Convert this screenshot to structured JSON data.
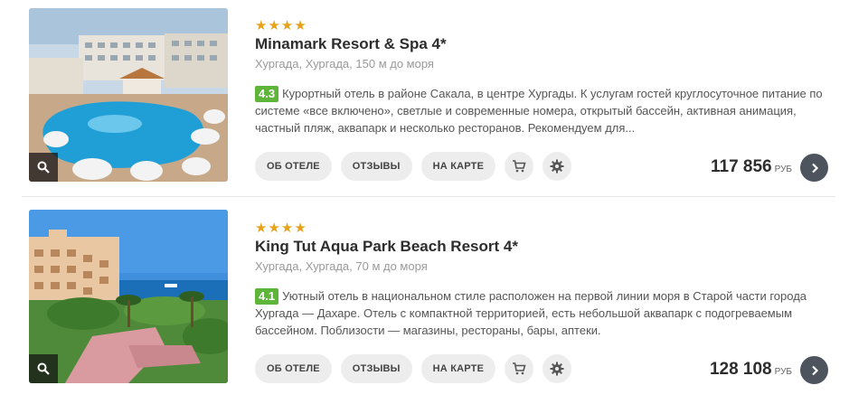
{
  "hotels": [
    {
      "stars": "★★★★",
      "name": "Minamark Resort & Spa 4*",
      "location": "Хургада, Хургада, 150 м до моря",
      "rating": "4.3",
      "description": "Курортный отель в районе Сакала, в центре Хургады. К услугам гостей круглосуточное питание по системе «все включено», светлые и современные номера, открытый бассейн, активная анимация, частный пляж, аквапарк и несколько ресторанов. Рекомендуем для...",
      "buttons": {
        "about": "ОБ ОТЕЛЕ",
        "reviews": "ОТЗЫВЫ",
        "map": "НА КАРТЕ"
      },
      "price": "117 856",
      "currency": "РУБ"
    },
    {
      "stars": "★★★★",
      "name": "King Tut Aqua Park Beach Resort 4*",
      "location": "Хургада, Хургада, 70 м до моря",
      "rating": "4.1",
      "description": "Уютный отель в национальном стиле расположен на первой линии моря в Старой части города Хургада — Дахаре. Отель с компактной территорией, есть небольшой аквапарк с подогреваемым бассейном. Поблизости — магазины, рестораны, бары, аптеки.",
      "buttons": {
        "about": "ОБ ОТЕЛЕ",
        "reviews": "ОТЗЫВЫ",
        "map": "НА КАРТЕ"
      },
      "price": "128 108",
      "currency": "РУБ"
    }
  ],
  "colors": {
    "star": "#e5a21a",
    "rating_badge": "#5fb53a",
    "pill_bg": "#ededed",
    "go_button": "#4d545e"
  },
  "icons": [
    "search-icon",
    "cart-icon",
    "gear-icon",
    "chevron-right-icon"
  ]
}
